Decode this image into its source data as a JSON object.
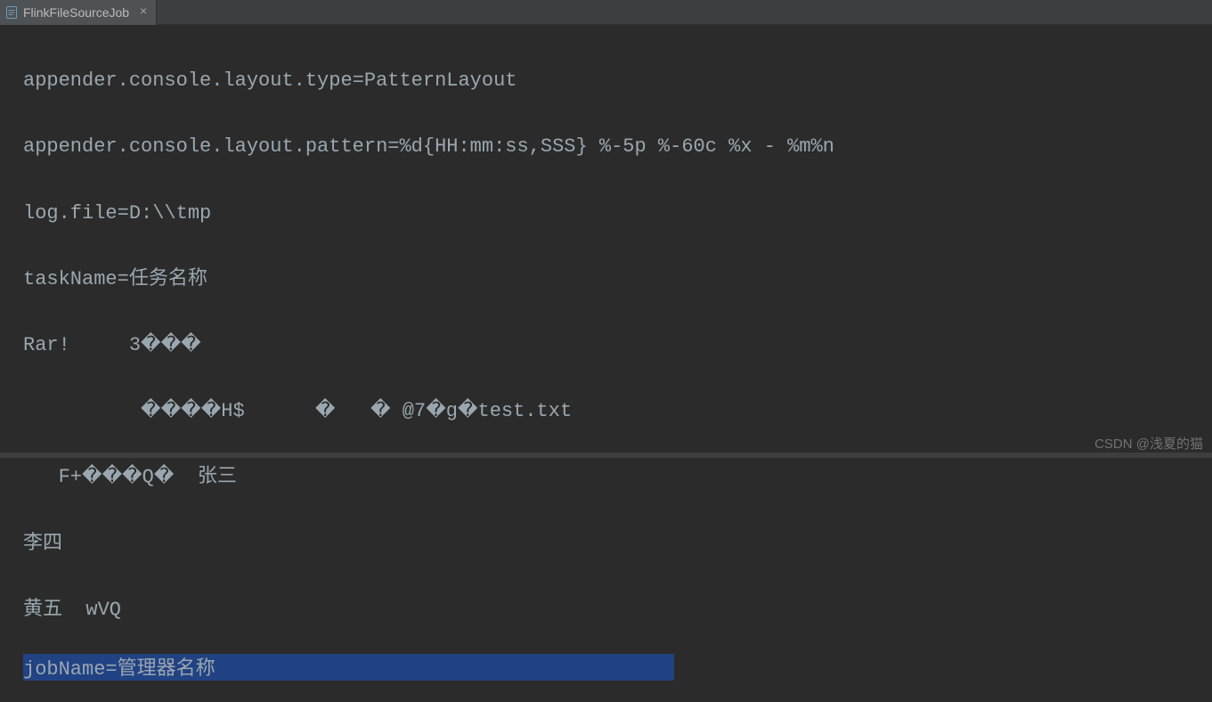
{
  "tab": {
    "label": "FlinkFileSourceJob",
    "close_glyph": "×"
  },
  "editor": {
    "lines": [
      "appender.console.layout.type=PatternLayout",
      "appender.console.layout.pattern=%d{HH:mm:ss,SSS} %-5p %-60c %x - %m%n",
      "log.file=D:\\\\tmp",
      "taskName=任务名称",
      "Rar!     3���",
      "          ����H$      �   � @7�g�test.txt",
      "   F+���Q�  张三",
      "李四",
      "黄五  wVQ"
    ],
    "selected_line": "jobName=管理器名称                                       "
  },
  "watermark": "CSDN @浅夏的猫"
}
